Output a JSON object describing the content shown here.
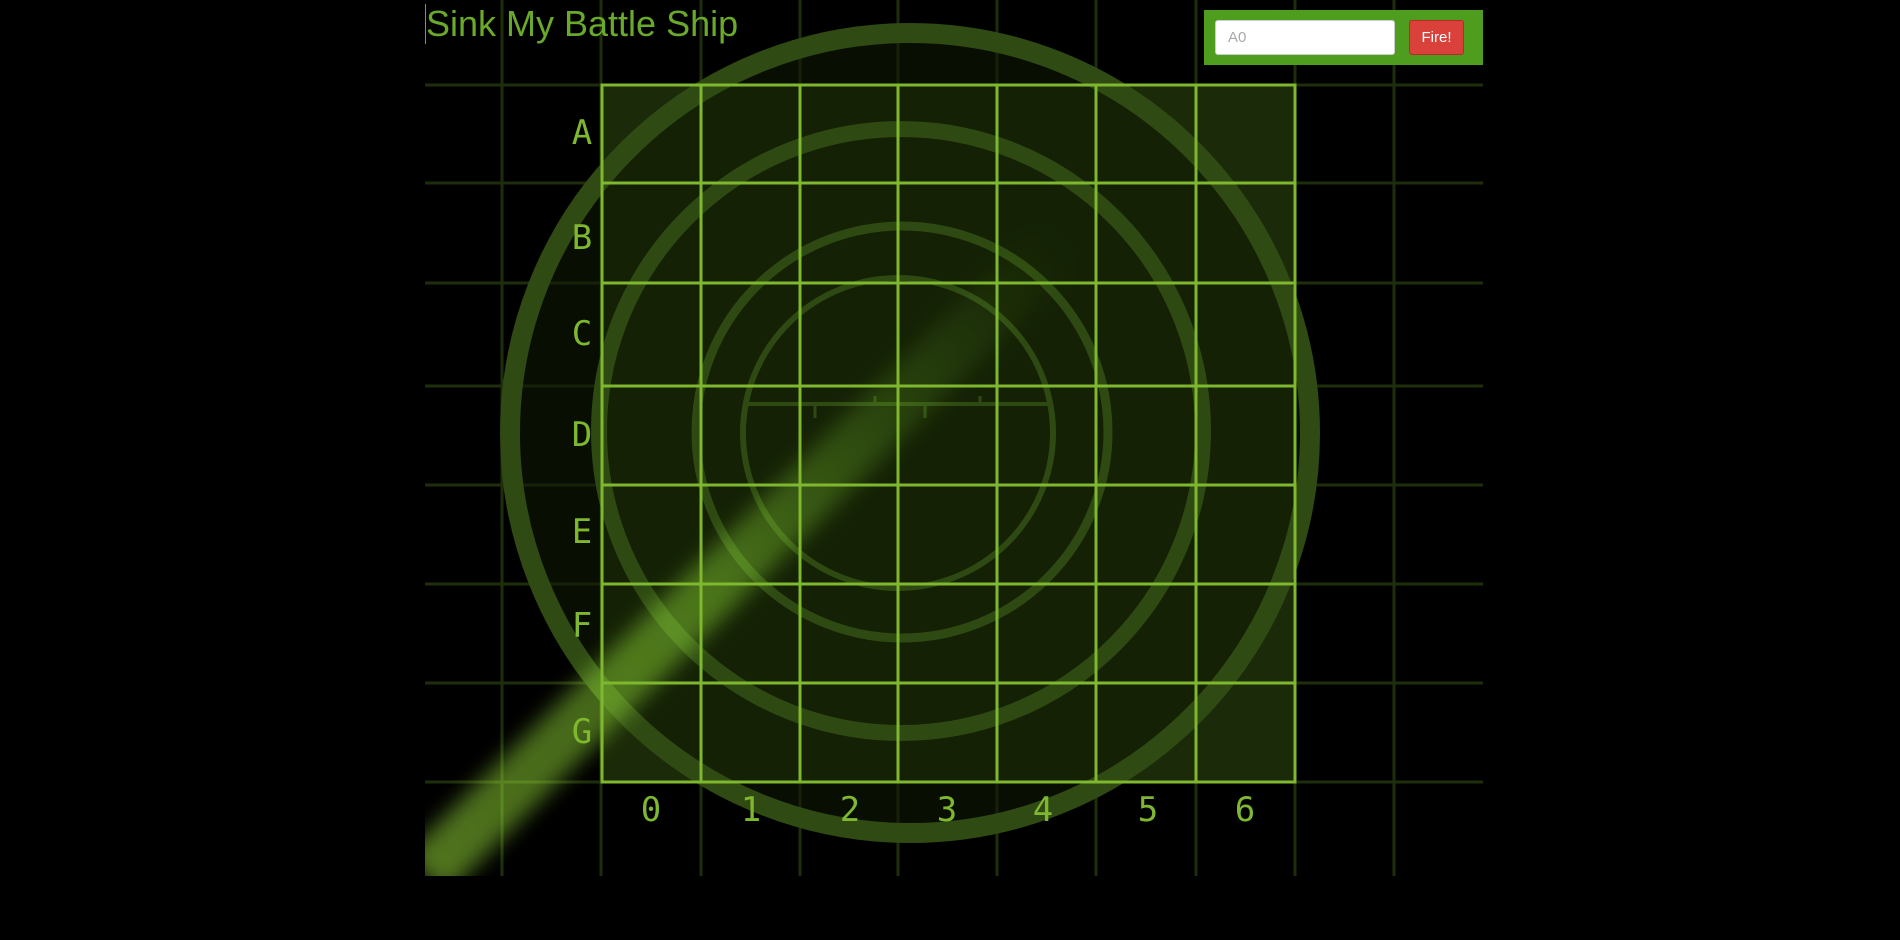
{
  "page": {
    "title": "Sink My Battle Ship"
  },
  "form": {
    "guess_placeholder": "A0",
    "fire_label": "Fire!"
  },
  "board": {
    "rows": [
      "A",
      "B",
      "C",
      "D",
      "E",
      "F",
      "G"
    ],
    "columns": [
      "0",
      "1",
      "2",
      "3",
      "4",
      "5",
      "6"
    ]
  },
  "colors": {
    "title": "#6aaa2a",
    "form_background": "#4f9d1e",
    "fire_button": "#d9413a",
    "grid_line": "#7fb82e",
    "radar_ring": "#2e4a12",
    "background": "#000000"
  }
}
